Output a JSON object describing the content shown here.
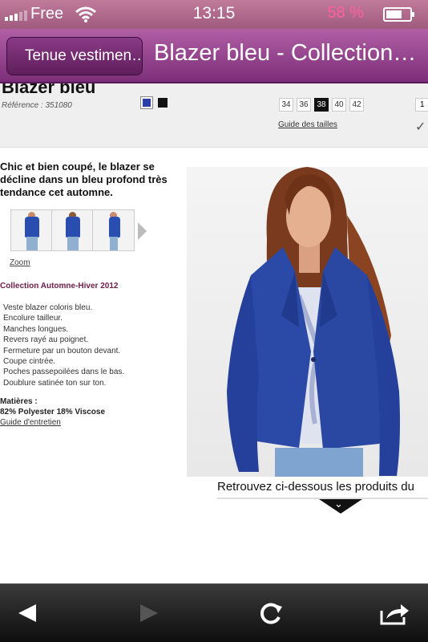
{
  "status_bar": {
    "carrier": "Free",
    "time": "13:15",
    "battery": "58 %",
    "battery_level": 0.58
  },
  "nav_bar": {
    "back_label": "Tenue vestimen…",
    "title": "Blazer bleu - Collection…"
  },
  "product": {
    "name": "Blazer bleu",
    "reference": "Référence : 351080",
    "colors": [
      "#2a3fa8",
      "#111111"
    ],
    "sizes": [
      "34",
      "36",
      "38",
      "40",
      "42"
    ],
    "selected_size": "38",
    "size_guide": "Guide des tailles",
    "quantity": "1",
    "description": "Chic et bien coupé, le blazer se décline dans un bleu profond très tendance cet automne.",
    "zoom": "Zoom",
    "collection": "Collection Automne-Hiver 2012",
    "features": [
      "Veste blazer coloris bleu.",
      "Encolure tailleur.",
      "Manches longues.",
      "Revers rayé au poignet.",
      "Fermeture par un bouton devant.",
      "Coupe cintrée.",
      "Poches passepoilées dans le bas.",
      "Doublure satinée ton sur ton."
    ],
    "materials_label": "Matières :",
    "materials": "82% Polyester 18% Viscose",
    "care_guide": "Guide d'entretien"
  },
  "related": {
    "text": "Retrouvez ci-dessous les produits du"
  },
  "toolbar": {
    "icons": [
      "back-arrow-icon",
      "forward-arrow-icon",
      "reload-icon",
      "share-icon"
    ]
  }
}
